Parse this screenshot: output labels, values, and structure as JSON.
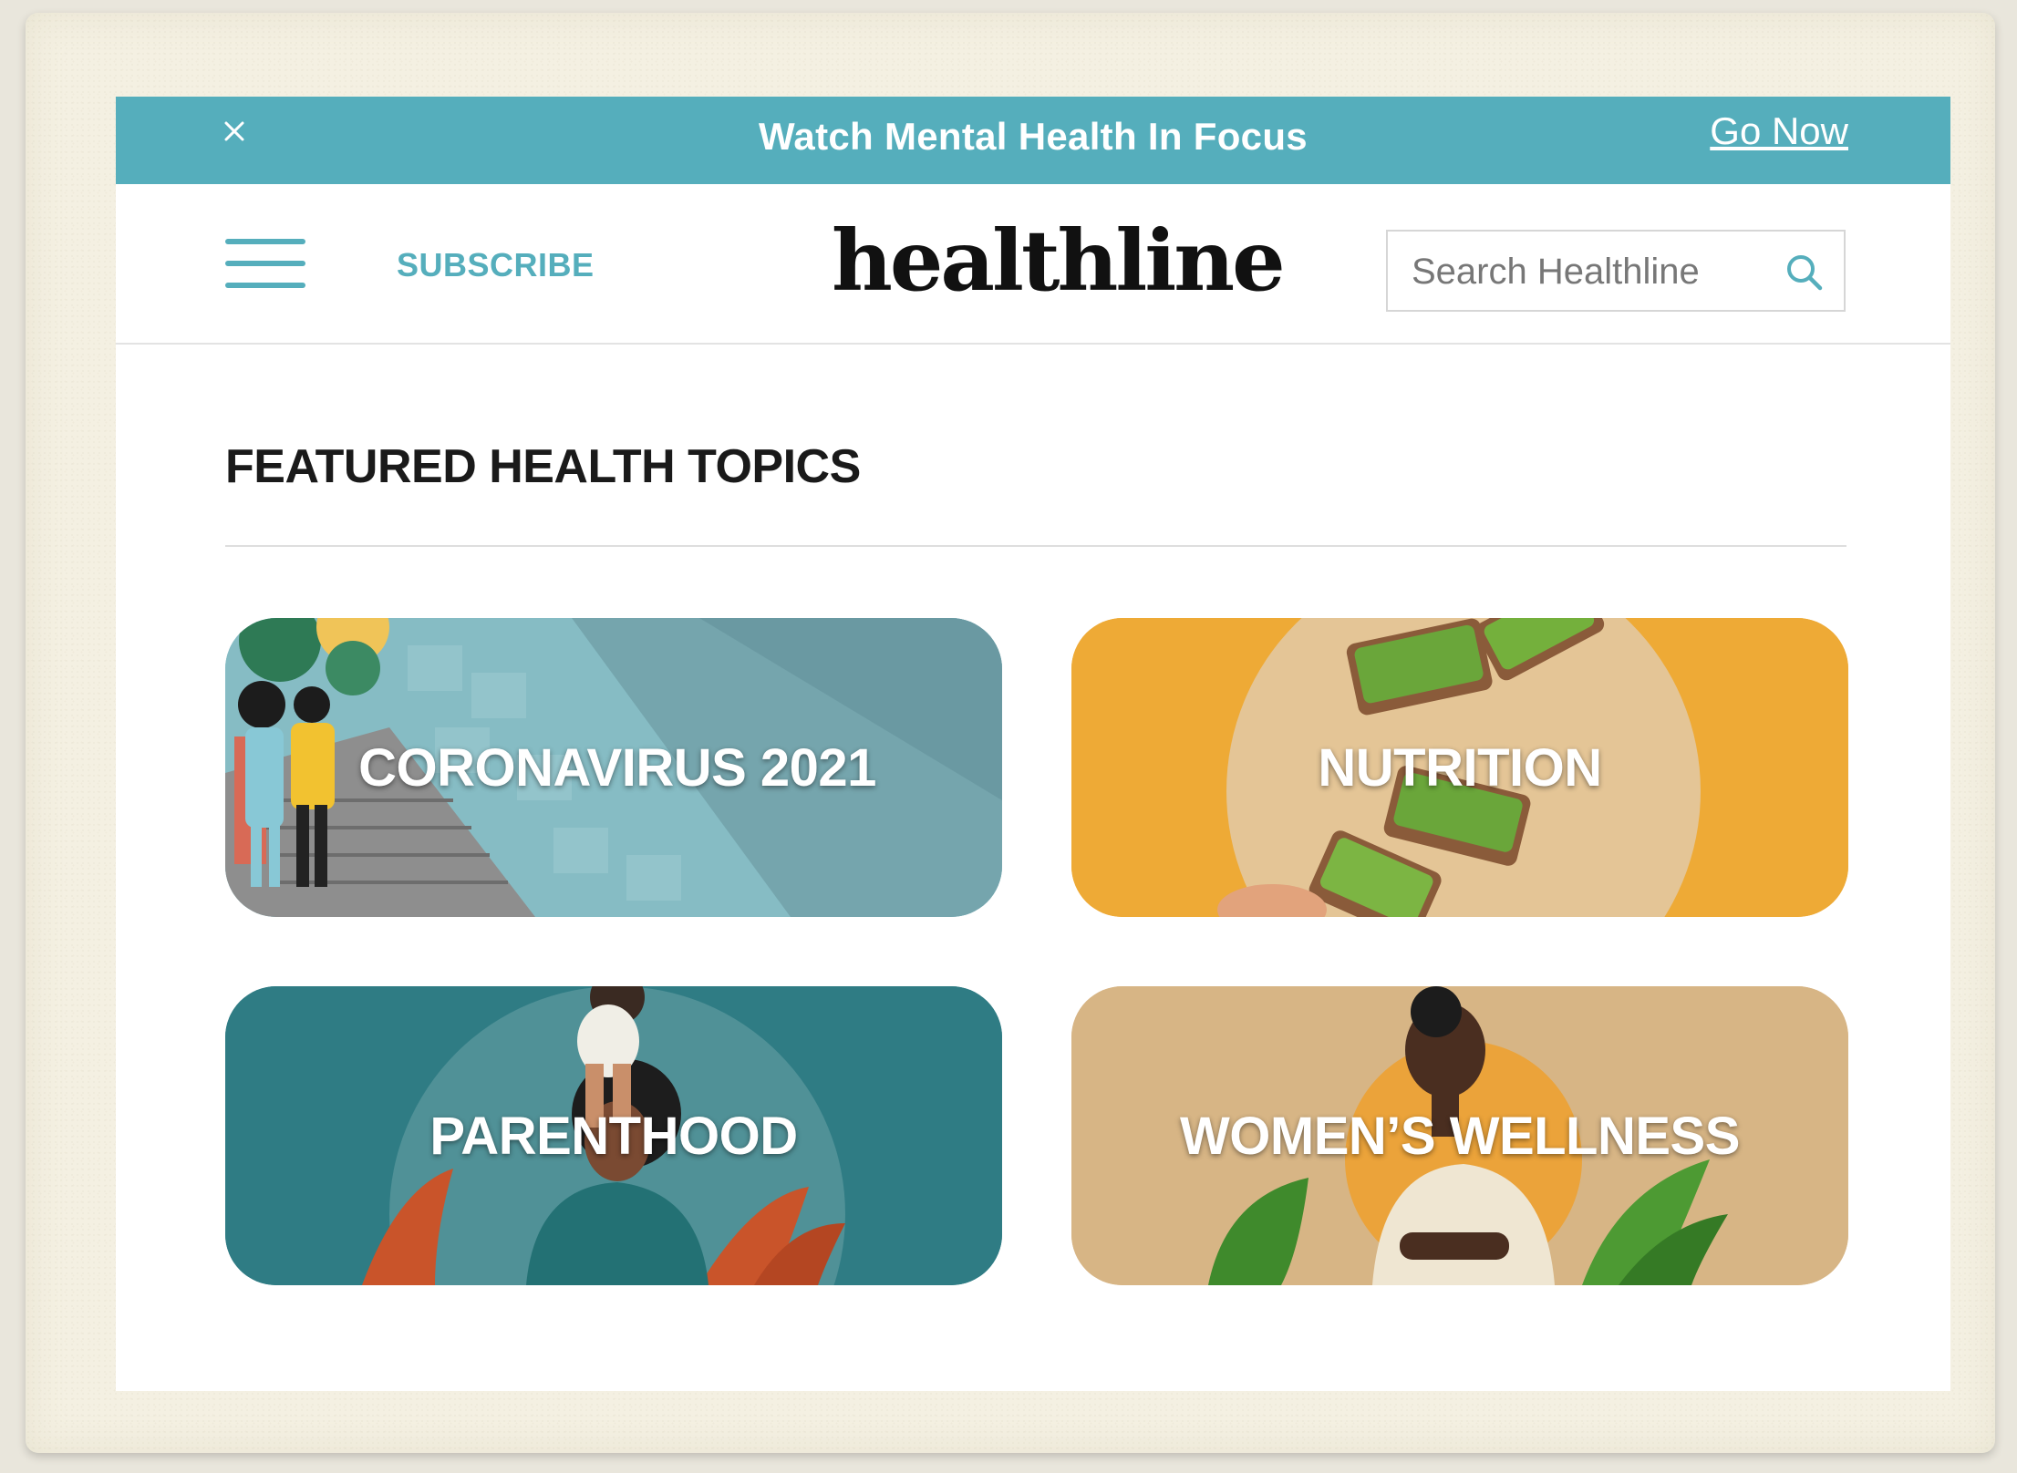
{
  "banner": {
    "text": "Watch Mental Health In Focus",
    "link": "Go Now",
    "background_color": "#55aebc"
  },
  "header": {
    "subscribe_label": "SUBSCRIBE",
    "logo": "healthline",
    "search_placeholder": "Search Healthline",
    "accent_color": "#55aebc"
  },
  "featured": {
    "title": "FEATURED HEALTH TOPICS",
    "cards": [
      {
        "label": "CORONAVIRUS 2021",
        "color": "#7fb9c1"
      },
      {
        "label": "NUTRITION",
        "color": "#eeaa36"
      },
      {
        "label": "PARENTHOOD",
        "color": "#2f7c84"
      },
      {
        "label": "WOMEN’S WELLNESS",
        "color": "#d7b585"
      }
    ]
  },
  "icons": {
    "close": "close-icon",
    "menu": "hamburger-menu-icon",
    "search": "search-icon"
  }
}
